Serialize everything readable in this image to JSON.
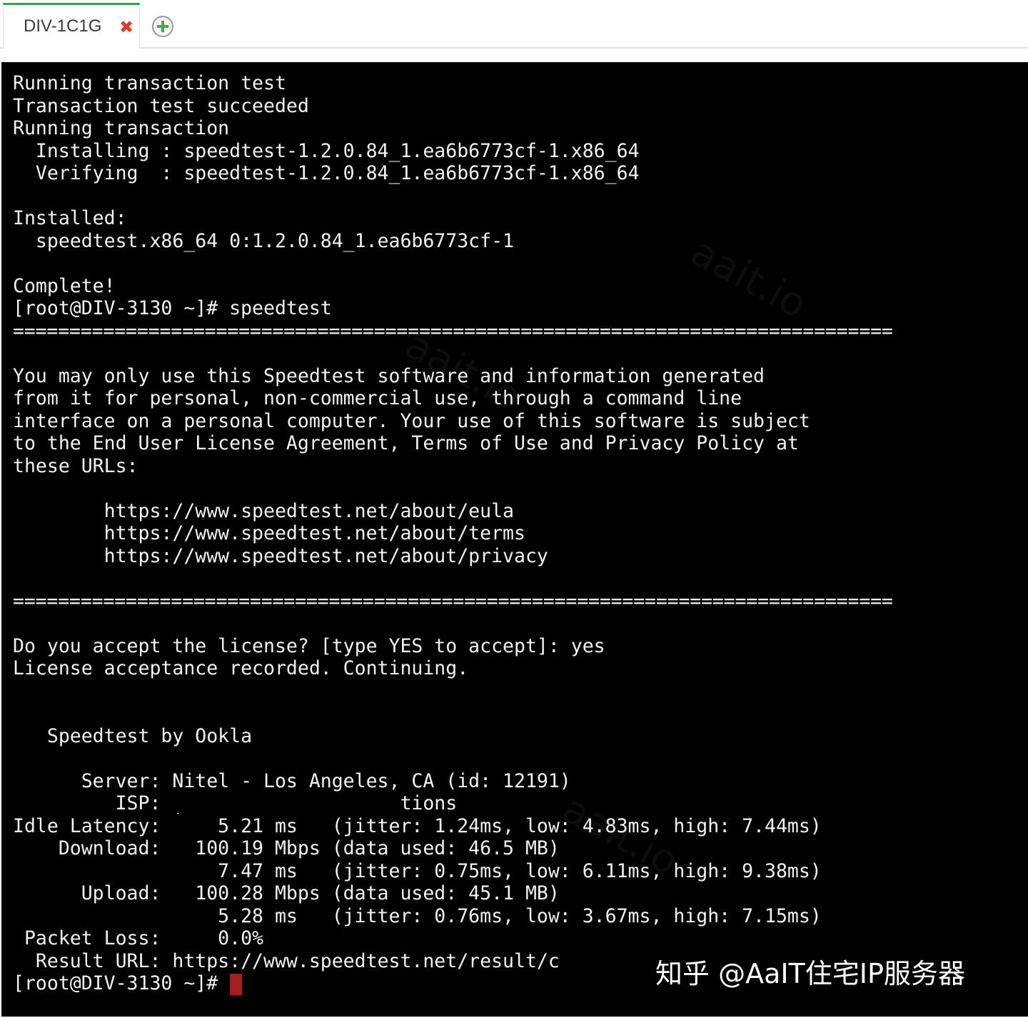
{
  "tabbar": {
    "active_tab_label": "DIV-1C1G",
    "close_glyph": "✖",
    "accent_color": "#2fa34a",
    "close_color": "#e23a2a",
    "add_icon": "plus-circle-icon"
  },
  "terminal": {
    "background": "#000000",
    "foreground": "#f2f2f2",
    "cursor_color": "#a51d1d",
    "lines": [
      "Running transaction test",
      "Transaction test succeeded",
      "Running transaction",
      "  Installing : speedtest-1.2.0.84_1.ea6b6773cf-1.x86_64",
      "  Verifying  : speedtest-1.2.0.84_1.ea6b6773cf-1.x86_64",
      "",
      "Installed:",
      "  speedtest.x86_64 0:1.2.0.84_1.ea6b6773cf-1",
      "",
      "Complete!",
      "[root@DIV-3130 ~]# speedtest",
      "==============================================================================",
      "",
      "You may only use this Speedtest software and information generated",
      "from it for personal, non-commercial use, through a command line",
      "interface on a personal computer. Your use of this software is subject",
      "to the End User License Agreement, Terms of Use and Privacy Policy at",
      "these URLs:",
      "",
      "        https://www.speedtest.net/about/eula",
      "        https://www.speedtest.net/about/terms",
      "        https://www.speedtest.net/about/privacy",
      "",
      "==============================================================================",
      "",
      "Do you accept the license? [type YES to accept]: yes",
      "License acceptance recorded. Continuing.",
      "",
      "",
      "   Speedtest by Ookla",
      "",
      "      Server: Nitel - Los Angeles, CA (id: 12191)",
      "         ISP: |                   tions",
      "Idle Latency:     5.21 ms   (jitter: 1.24ms, low: 4.83ms, high: 7.44ms)",
      "    Download:   100.19 Mbps (data used: 46.5 MB)",
      "                  7.47 ms   (jitter: 0.75ms, low: 6.11ms, high: 9.38ms)",
      "      Upload:   100.28 Mbps (data used: 45.1 MB)",
      "                  5.28 ms   (jitter: 0.76ms, low: 3.67ms, high: 7.15ms)",
      " Packet Loss:     0.0%",
      "  Result URL: https://www.speedtest.net/result/c",
      "[root@DIV-3130 ~]# "
    ]
  },
  "watermark_text": "aait.io",
  "overlay_credit": "知乎 @AaIT住宅IP服务器"
}
